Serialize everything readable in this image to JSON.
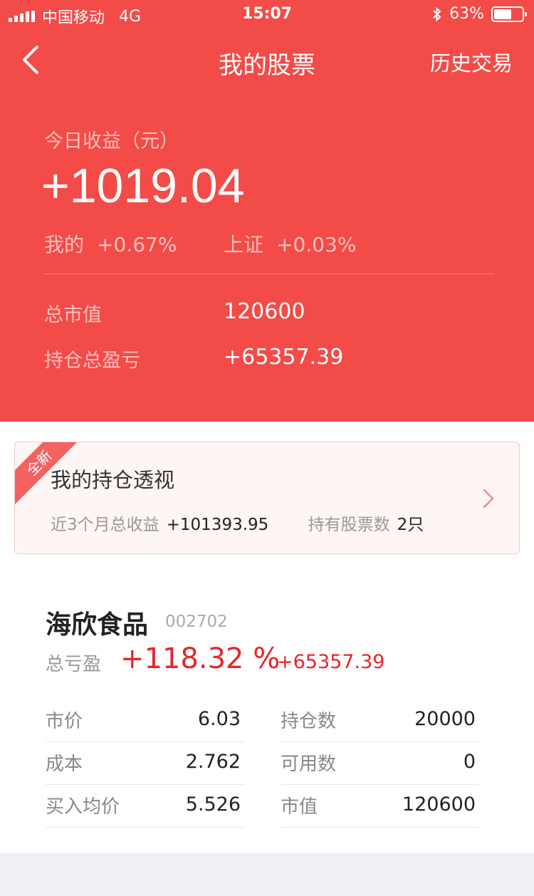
{
  "status_bar": {
    "carrier": "中国移动",
    "network": "4G",
    "time": "15:07",
    "battery": "63%",
    "battery_level": 0.63
  },
  "nav": {
    "title": "我的股票",
    "history_label": "历史交易"
  },
  "summary": {
    "today_label": "今日收益（元）",
    "today_value": "+1019.04",
    "mine_label": "我的",
    "mine_pct": "+0.67%",
    "index_label": "上证",
    "index_pct": "+0.03%",
    "market_value_label": "总市值",
    "market_value": "120600",
    "position_pl_label": "持仓总盈亏",
    "position_pl": "+65357.39"
  },
  "promo": {
    "badge": "全新",
    "title": "我的持仓透视",
    "return_label": "近3个月总收益",
    "return_value": "+101393.95",
    "count_label": "持有股票数",
    "count_value": "2只"
  },
  "stock": {
    "name": "海欣食品",
    "code": "002702",
    "pl_label": "总亏盈",
    "pl_pct": "+118.32 %",
    "pl_amount": "+65357.39",
    "fields": [
      {
        "label": "市价",
        "value": "6.03"
      },
      {
        "label": "持仓数",
        "value": "20000"
      },
      {
        "label": "成本",
        "value": "2.762"
      },
      {
        "label": "可用数",
        "value": "0"
      },
      {
        "label": "买入均价",
        "value": "5.526"
      },
      {
        "label": "市值",
        "value": "120600"
      }
    ]
  },
  "colors": {
    "header_red": "#f34b47",
    "gain_red": "#e8262a"
  }
}
